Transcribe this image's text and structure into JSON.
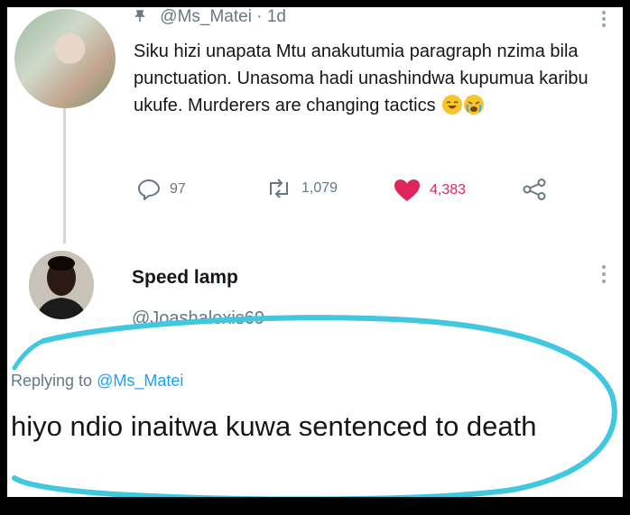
{
  "tweet": {
    "handle": "@Ms_Matei",
    "time": "· 1d",
    "text": "Siku hizi unapata Mtu anakutumia paragraph nzima bila punctuation. Unasoma hadi unashindwa  kupumua karibu ukufe. Murderers are changing tactics",
    "emojis": [
      "laughing-emoji",
      "crying-emoji"
    ],
    "replies": "97",
    "retweets": "1,079",
    "likes": "4,383",
    "colors": {
      "like": "#e0245e",
      "secondary": "#657786",
      "link": "#1da1f2"
    }
  },
  "reply": {
    "name": "Speed lamp",
    "handle": "@Joashalexis69",
    "replying_prefix": "Replying to",
    "replying_to": "@Ms_Matei",
    "text": "hiyo ndio inaitwa kuwa sentenced to death"
  },
  "annotation": {
    "color": "#40c8e0"
  }
}
